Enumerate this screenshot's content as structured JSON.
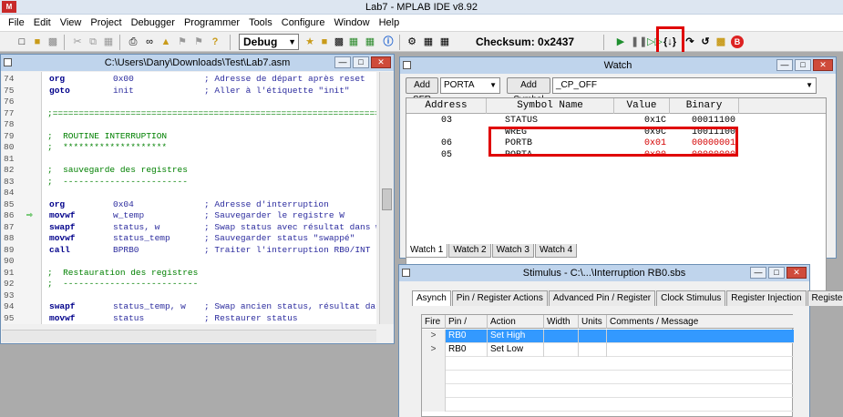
{
  "app": {
    "title": "Lab7 - MPLAB IDE v8.92",
    "logo_text": "M"
  },
  "menu": [
    "File",
    "Edit",
    "View",
    "Project",
    "Debugger",
    "Programmer",
    "Tools",
    "Configure",
    "Window",
    "Help"
  ],
  "toolbar": {
    "config": "Debug",
    "checksum": "Checksum:  0x2437"
  },
  "editor": {
    "title": "C:\\Users\\Dany\\Downloads\\Test\\Lab7.asm",
    "lines": [
      {
        "n": "74",
        "instr": "org",
        "op": "0x00",
        "comment": "; Adresse de départ après reset"
      },
      {
        "n": "75",
        "instr": "goto",
        "op": "init",
        "comment": "; Aller à l'étiquette \"init\""
      },
      {
        "n": "76",
        "text": ""
      },
      {
        "n": "77",
        "text": ";=========================================================================="
      },
      {
        "n": "78",
        "text": ""
      },
      {
        "n": "79",
        "text": ";  ROUTINE INTERRUPTION"
      },
      {
        "n": "80",
        "text": ";  ********************"
      },
      {
        "n": "81",
        "text": ""
      },
      {
        "n": "82",
        "text": ";  sauvegarde des registres"
      },
      {
        "n": "83",
        "text": ";  ------------------------"
      },
      {
        "n": "84",
        "text": ""
      },
      {
        "n": "85",
        "instr": "org",
        "op": "0x04",
        "comment": "; Adresse d'interruption"
      },
      {
        "n": "86",
        "instr": "movwf",
        "op": "w_temp",
        "comment": "; Sauvegarder le registre W",
        "current": true
      },
      {
        "n": "87",
        "instr": "swapf",
        "op": "status, w",
        "comment": "; Swap status avec résultat dans w"
      },
      {
        "n": "88",
        "instr": "movwf",
        "op": "status_temp",
        "comment": "; Sauvegarder status \"swappé\""
      },
      {
        "n": "89",
        "instr": "call",
        "op": "BPRB0",
        "comment": "; Traiter l'interruption RB0/INT"
      },
      {
        "n": "90",
        "text": ""
      },
      {
        "n": "91",
        "text": ";  Restauration des registres"
      },
      {
        "n": "92",
        "text": ";  --------------------------"
      },
      {
        "n": "93",
        "text": ""
      },
      {
        "n": "94",
        "instr": "swapf",
        "op": "status_temp, w",
        "comment": "; Swap ancien status, résultat dan"
      },
      {
        "n": "95",
        "instr": "movwf",
        "op": "status",
        "comment": "; Restaurer status"
      }
    ]
  },
  "watch": {
    "title": "Watch",
    "add_sfr_label": "Add SFR",
    "sfr_value": "PORTA",
    "add_symbol_label": "Add Symbol",
    "symbol_value": "_CP_OFF",
    "columns": [
      "Address",
      "Symbol Name",
      "Value",
      "Binary"
    ],
    "rows": [
      {
        "address": "03",
        "symbol": "STATUS",
        "value": "0x1C",
        "binary": "00011100",
        "changed": false
      },
      {
        "address": "",
        "symbol": "WREG",
        "value": "0x9C",
        "binary": "10011100",
        "changed": false,
        "clipped": true
      },
      {
        "address": "06",
        "symbol": "PORTB",
        "value": "0x01",
        "binary": "00000001",
        "changed": true
      },
      {
        "address": "05",
        "symbol": "PORTA",
        "value": "0x00",
        "binary": "00000000",
        "changed": true,
        "clipped": true
      }
    ],
    "tabs": [
      "Watch 1",
      "Watch 2",
      "Watch 3",
      "Watch 4"
    ]
  },
  "stimulus": {
    "title": "Stimulus - C:\\...\\Interruption RB0.sbs",
    "tabs": [
      "Asynch",
      "Pin / Register Actions",
      "Advanced Pin / Register",
      "Clock Stimulus",
      "Register Injection",
      "Register Trace"
    ],
    "columns": [
      "Fire",
      "Pin / SFR",
      "Action",
      "Width",
      "Units",
      "Comments / Message"
    ],
    "rows": [
      {
        "fire": ">",
        "pin": "RB0",
        "action": "Set High"
      },
      {
        "fire": ">",
        "pin": "RB0",
        "action": "Set Low"
      }
    ]
  },
  "colors": {
    "highlight": "#e00000",
    "changed_value": "#d40000",
    "selection": "#3399ff"
  }
}
